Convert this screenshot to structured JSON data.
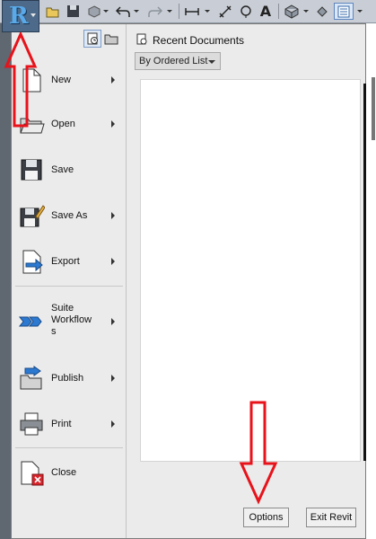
{
  "app": {
    "logo_letter": "R"
  },
  "menu": {
    "items": [
      {
        "label": "New",
        "icon": "new-document-icon",
        "submenu": true
      },
      {
        "label": "Open",
        "icon": "open-folder-icon",
        "submenu": true
      },
      {
        "label": "Save",
        "icon": "floppy-disk-icon",
        "submenu": false
      },
      {
        "label": "Save As",
        "icon": "save-as-icon",
        "submenu": true
      },
      {
        "label": "Export",
        "icon": "export-icon",
        "submenu": true
      },
      {
        "label_lines": [
          "Suite",
          "Workflow",
          "s"
        ],
        "icon": "suite-workflows-icon",
        "submenu": true
      },
      {
        "label": "Publish",
        "icon": "publish-icon",
        "submenu": true
      },
      {
        "label": "Print",
        "icon": "printer-icon",
        "submenu": true
      },
      {
        "label": "Close",
        "icon": "close-document-icon",
        "submenu": false
      }
    ]
  },
  "recent": {
    "title": "Recent Documents",
    "order_select": "By Ordered List"
  },
  "footer": {
    "options_label": "Options",
    "exit_label": "Exit Revit"
  },
  "colors": {
    "annotation_red": "#e8121b",
    "menu_background": "#ebebeb",
    "app_button": "#4d6a8a"
  }
}
